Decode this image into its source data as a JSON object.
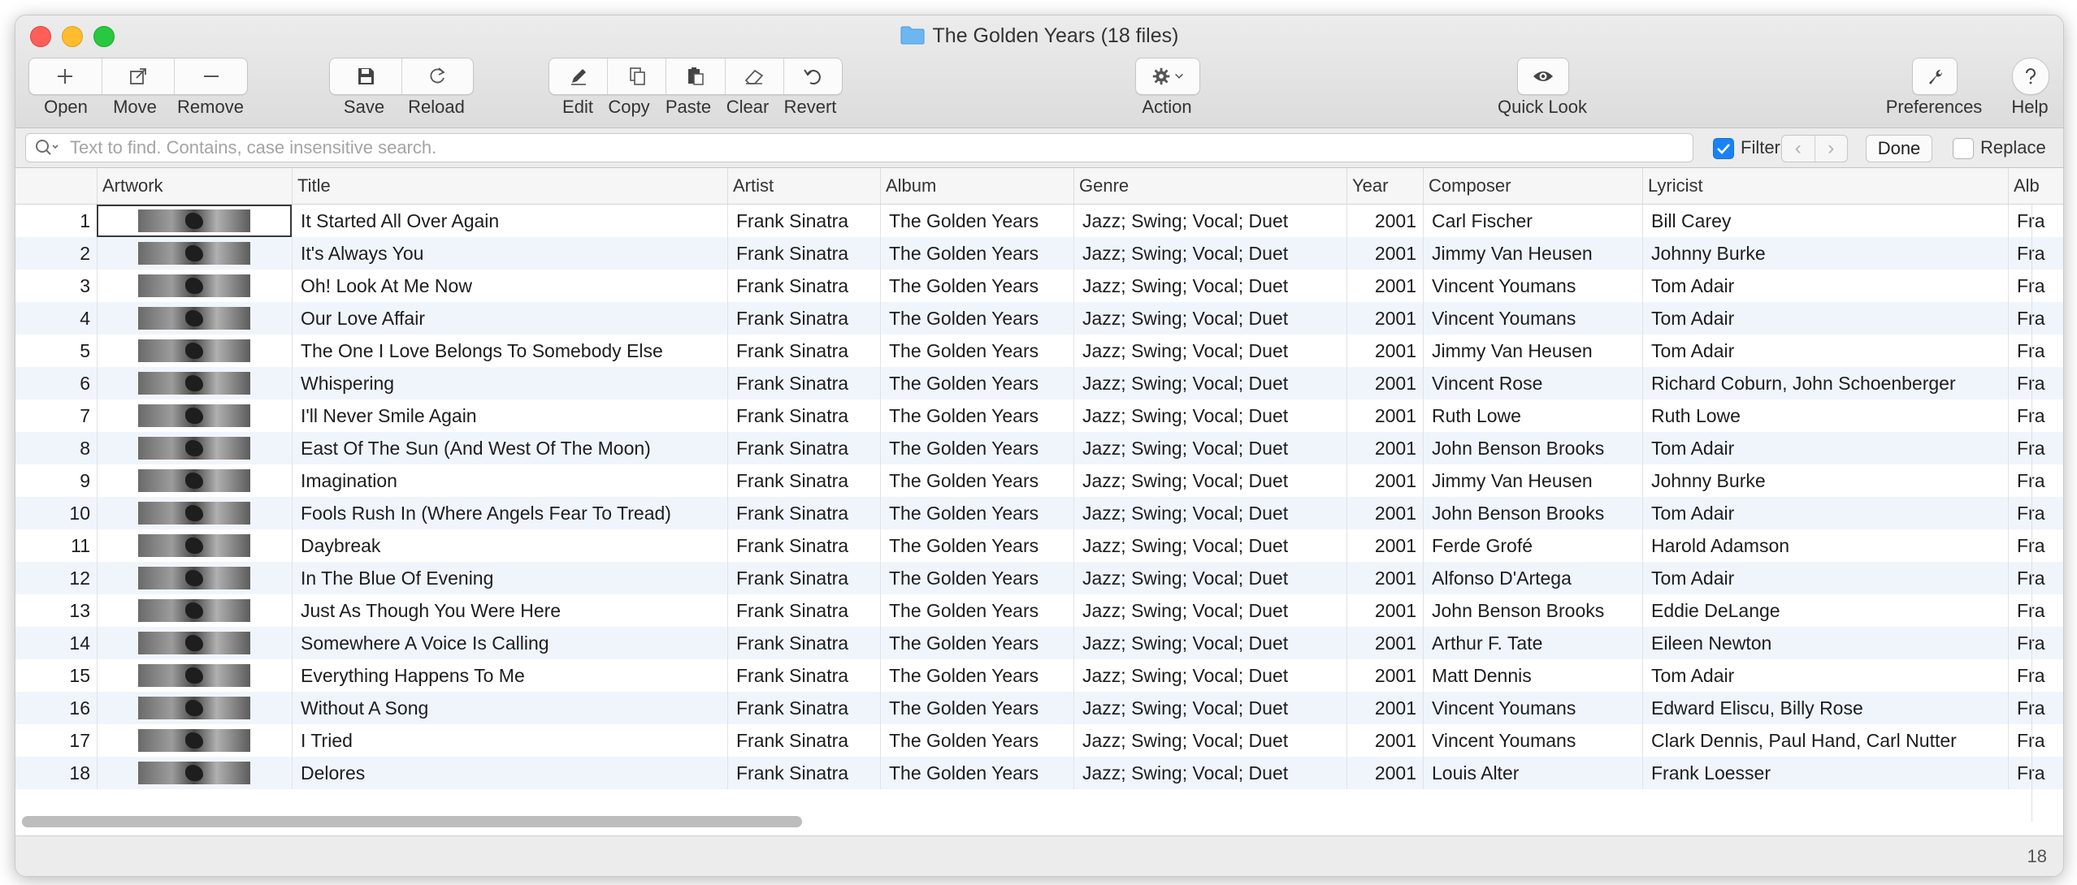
{
  "window": {
    "title": "The Golden Years (18 files)"
  },
  "toolbar": {
    "open": "Open",
    "move": "Move",
    "remove": "Remove",
    "save": "Save",
    "reload": "Reload",
    "edit": "Edit",
    "copy": "Copy",
    "paste": "Paste",
    "clear": "Clear",
    "revert": "Revert",
    "action": "Action",
    "quicklook": "Quick Look",
    "preferences": "Preferences",
    "help": "Help"
  },
  "search": {
    "placeholder": "Text to find. Contains, case insensitive search.",
    "filter_label": "Filter",
    "filter_checked": true,
    "done_label": "Done",
    "replace_label": "Replace",
    "replace_checked": false
  },
  "columns": [
    "Artwork",
    "Title",
    "Artist",
    "Album",
    "Genre",
    "Year",
    "Composer",
    "Lyricist",
    "Alb"
  ],
  "rows": [
    {
      "n": "1",
      "title": "It Started All Over Again",
      "artist": "Frank Sinatra",
      "album": "The Golden Years",
      "genre": "Jazz; Swing; Vocal; Duet",
      "year": "2001",
      "composer": "Carl Fischer",
      "lyricist": "Bill Carey",
      "more": "Fra"
    },
    {
      "n": "2",
      "title": "It's Always You",
      "artist": "Frank Sinatra",
      "album": "The Golden Years",
      "genre": "Jazz; Swing; Vocal; Duet",
      "year": "2001",
      "composer": "Jimmy Van Heusen",
      "lyricist": "Johnny Burke",
      "more": "Fra"
    },
    {
      "n": "3",
      "title": "Oh! Look At Me Now",
      "artist": "Frank Sinatra",
      "album": "The Golden Years",
      "genre": "Jazz; Swing; Vocal; Duet",
      "year": "2001",
      "composer": "Vincent Youmans",
      "lyricist": "Tom Adair",
      "more": "Fra"
    },
    {
      "n": "4",
      "title": "Our Love Affair",
      "artist": "Frank Sinatra",
      "album": "The Golden Years",
      "genre": "Jazz; Swing; Vocal; Duet",
      "year": "2001",
      "composer": "Vincent Youmans",
      "lyricist": "Tom Adair",
      "more": "Fra"
    },
    {
      "n": "5",
      "title": "The One I Love Belongs To Somebody Else",
      "artist": "Frank Sinatra",
      "album": "The Golden Years",
      "genre": "Jazz; Swing; Vocal; Duet",
      "year": "2001",
      "composer": "Jimmy Van Heusen",
      "lyricist": "Tom Adair",
      "more": "Fra"
    },
    {
      "n": "6",
      "title": "Whispering",
      "artist": "Frank Sinatra",
      "album": "The Golden Years",
      "genre": "Jazz; Swing; Vocal; Duet",
      "year": "2001",
      "composer": "Vincent Rose",
      "lyricist": "Richard Coburn, John Schoenberger",
      "more": "Fra"
    },
    {
      "n": "7",
      "title": "I'll Never Smile Again",
      "artist": "Frank Sinatra",
      "album": "The Golden Years",
      "genre": "Jazz; Swing; Vocal; Duet",
      "year": "2001",
      "composer": "Ruth Lowe",
      "lyricist": "Ruth Lowe",
      "more": "Fra"
    },
    {
      "n": "8",
      "title": "East Of The Sun (And West Of The Moon)",
      "artist": "Frank Sinatra",
      "album": "The Golden Years",
      "genre": "Jazz; Swing; Vocal; Duet",
      "year": "2001",
      "composer": "John Benson Brooks",
      "lyricist": "Tom Adair",
      "more": "Fra"
    },
    {
      "n": "9",
      "title": "Imagination",
      "artist": "Frank Sinatra",
      "album": "The Golden Years",
      "genre": "Jazz; Swing; Vocal; Duet",
      "year": "2001",
      "composer": "Jimmy Van Heusen",
      "lyricist": "Johnny Burke",
      "more": "Fra"
    },
    {
      "n": "10",
      "title": "Fools Rush In (Where Angels Fear To Tread)",
      "artist": "Frank Sinatra",
      "album": "The Golden Years",
      "genre": "Jazz; Swing; Vocal; Duet",
      "year": "2001",
      "composer": "John Benson Brooks",
      "lyricist": "Tom Adair",
      "more": "Fra"
    },
    {
      "n": "11",
      "title": "Daybreak",
      "artist": "Frank Sinatra",
      "album": "The Golden Years",
      "genre": "Jazz; Swing; Vocal; Duet",
      "year": "2001",
      "composer": "Ferde Grofé",
      "lyricist": "Harold Adamson",
      "more": "Fra"
    },
    {
      "n": "12",
      "title": "In The Blue Of Evening",
      "artist": "Frank Sinatra",
      "album": "The Golden Years",
      "genre": "Jazz; Swing; Vocal; Duet",
      "year": "2001",
      "composer": "Alfonso D'Artega",
      "lyricist": "Tom Adair",
      "more": "Fra"
    },
    {
      "n": "13",
      "title": "Just As Though You Were Here",
      "artist": "Frank Sinatra",
      "album": "The Golden Years",
      "genre": "Jazz; Swing; Vocal; Duet",
      "year": "2001",
      "composer": "John Benson Brooks",
      "lyricist": "Eddie DeLange",
      "more": "Fra"
    },
    {
      "n": "14",
      "title": "Somewhere A Voice Is Calling",
      "artist": "Frank Sinatra",
      "album": "The Golden Years",
      "genre": "Jazz; Swing; Vocal; Duet",
      "year": "2001",
      "composer": "Arthur F. Tate",
      "lyricist": "Eileen Newton",
      "more": "Fra"
    },
    {
      "n": "15",
      "title": "Everything Happens To Me",
      "artist": "Frank Sinatra",
      "album": "The Golden Years",
      "genre": "Jazz; Swing; Vocal; Duet",
      "year": "2001",
      "composer": "Matt Dennis",
      "lyricist": "Tom Adair",
      "more": "Fra"
    },
    {
      "n": "16",
      "title": "Without A Song",
      "artist": "Frank Sinatra",
      "album": "The Golden Years",
      "genre": "Jazz; Swing; Vocal; Duet",
      "year": "2001",
      "composer": "Vincent Youmans",
      "lyricist": "Edward Eliscu, Billy Rose",
      "more": "Fra"
    },
    {
      "n": "17",
      "title": "I Tried",
      "artist": "Frank Sinatra",
      "album": "The Golden Years",
      "genre": "Jazz; Swing; Vocal; Duet",
      "year": "2001",
      "composer": "Vincent Youmans",
      "lyricist": "Clark Dennis, Paul Hand, Carl Nutter",
      "more": "Fra"
    },
    {
      "n": "18",
      "title": "Delores",
      "artist": "Frank Sinatra",
      "album": "The Golden Years",
      "genre": "Jazz; Swing; Vocal; Duet",
      "year": "2001",
      "composer": "Louis Alter",
      "lyricist": "Frank Loesser",
      "more": "Fra"
    }
  ],
  "status": {
    "count": "18"
  },
  "colors": {
    "accent": "#1a82f7",
    "row_alt": "#f0f5fc",
    "close": "#ff5f57",
    "minimize": "#febc2e",
    "zoom": "#28c840"
  },
  "icons": [
    "plus-icon",
    "move-icon",
    "minus-icon",
    "save-icon",
    "reload-icon",
    "pencil-icon",
    "copy-icon",
    "paste-icon",
    "eraser-icon",
    "revert-icon",
    "gear-icon",
    "eye-icon",
    "wrench-icon",
    "question-icon",
    "search-icon",
    "folder-icon"
  ]
}
